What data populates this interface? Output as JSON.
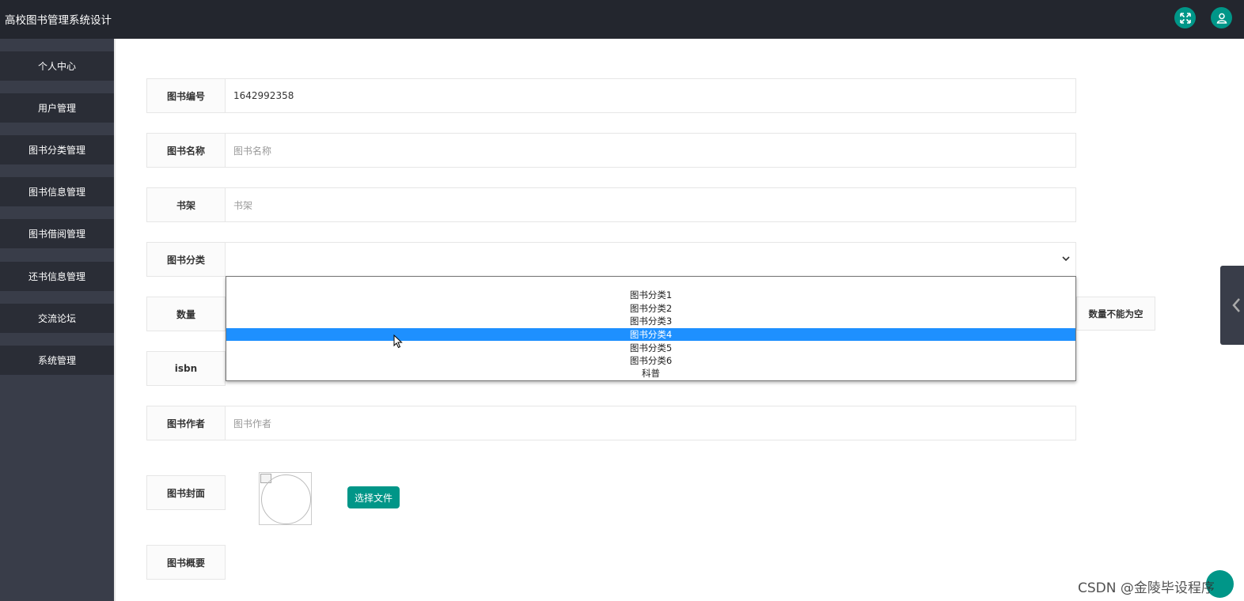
{
  "header": {
    "app_title": "高校图书管理系统设计",
    "fullscreen_icon": "expand-icon",
    "user_icon": "user-icon",
    "accent_color": "#009688"
  },
  "sidebar": {
    "items": [
      {
        "label": "个人中心"
      },
      {
        "label": "用户管理"
      },
      {
        "label": "图书分类管理"
      },
      {
        "label": "图书信息管理"
      },
      {
        "label": "图书借阅管理"
      },
      {
        "label": "还书信息管理"
      },
      {
        "label": "交流论坛"
      },
      {
        "label": "系统管理"
      }
    ]
  },
  "form": {
    "book_no": {
      "label": "图书编号",
      "value": "1642992358"
    },
    "book_name": {
      "label": "图书名称",
      "placeholder": "图书名称"
    },
    "shelf": {
      "label": "书架",
      "placeholder": "书架"
    },
    "category": {
      "label": "图书分类",
      "value": "",
      "options": [
        "",
        "图书分类1",
        "图书分类2",
        "图书分类3",
        "图书分类4",
        "图书分类5",
        "图书分类6",
        "科普"
      ],
      "highlighted": "图书分类4"
    },
    "quantity": {
      "label": "数量",
      "warning": "数量不能为空"
    },
    "isbn": {
      "label": "isbn"
    },
    "author": {
      "label": "图书作者",
      "placeholder": "图书作者"
    },
    "cover": {
      "label": "图书封面",
      "upload_label": "选择文件"
    },
    "summary": {
      "label": "图书概要"
    }
  },
  "watermark": "CSDN @金陵毕设程序",
  "colors": {
    "topbar": "#23262e",
    "sidebar": "#393d49",
    "menu_item": "#2a2d36",
    "selected_option": "#1e90ff"
  }
}
